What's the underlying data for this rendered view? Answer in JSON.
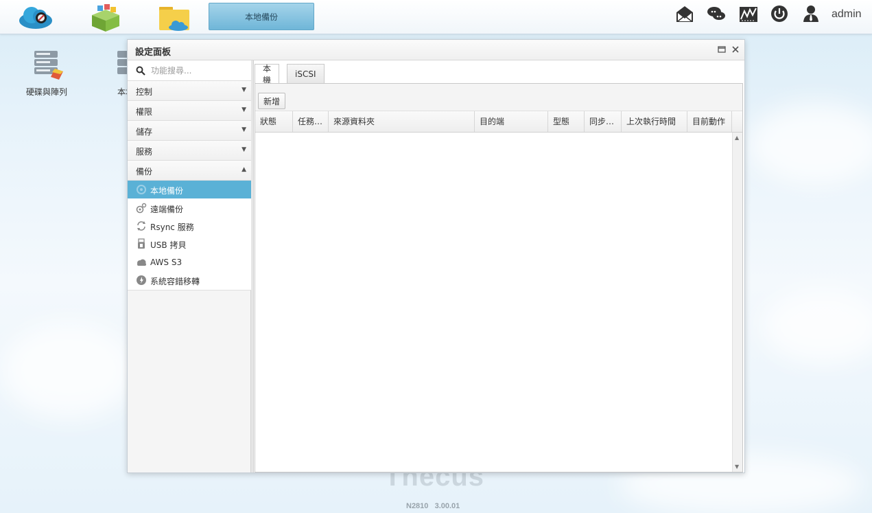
{
  "taskbar": {
    "active_window": "本地備份",
    "username": "admin"
  },
  "desktop": {
    "icons": [
      {
        "label": "硬碟與陣列"
      },
      {
        "label": "本地"
      }
    ],
    "model": "N2810",
    "version": "3.00.01",
    "brand_partial": "Thecus"
  },
  "window": {
    "title": "設定面板",
    "search_placeholder": "功能搜尋...",
    "categories": [
      {
        "label": "控制",
        "expanded": false
      },
      {
        "label": "權限",
        "expanded": false
      },
      {
        "label": "儲存",
        "expanded": false
      },
      {
        "label": "服務",
        "expanded": false
      },
      {
        "label": "備份",
        "expanded": true
      }
    ],
    "backup_items": [
      {
        "label": "本地備份",
        "icon": "local-backup-icon",
        "active": true
      },
      {
        "label": "遠端備份",
        "icon": "remote-backup-icon",
        "active": false
      },
      {
        "label": "Rsync 服務",
        "icon": "rsync-icon",
        "active": false
      },
      {
        "label": "USB 拷貝",
        "icon": "usb-icon",
        "active": false
      },
      {
        "label": "AWS S3",
        "icon": "cloud-icon",
        "active": false
      },
      {
        "label": "系統容錯移轉",
        "icon": "failover-icon",
        "active": false
      }
    ],
    "tabs": [
      {
        "label": "本機",
        "active": true
      },
      {
        "label": "iSCSI",
        "active": false
      }
    ],
    "toolbar": {
      "add_label": "新增"
    },
    "table": {
      "columns": [
        "狀態",
        "任務…",
        "來源資料夾",
        "目的端",
        "型態",
        "同步…",
        "上次執行時間",
        "目前動作"
      ],
      "rows": []
    }
  },
  "colors": {
    "accent": "#5ab1d6",
    "taskbar_active": "#8cc6e2"
  }
}
